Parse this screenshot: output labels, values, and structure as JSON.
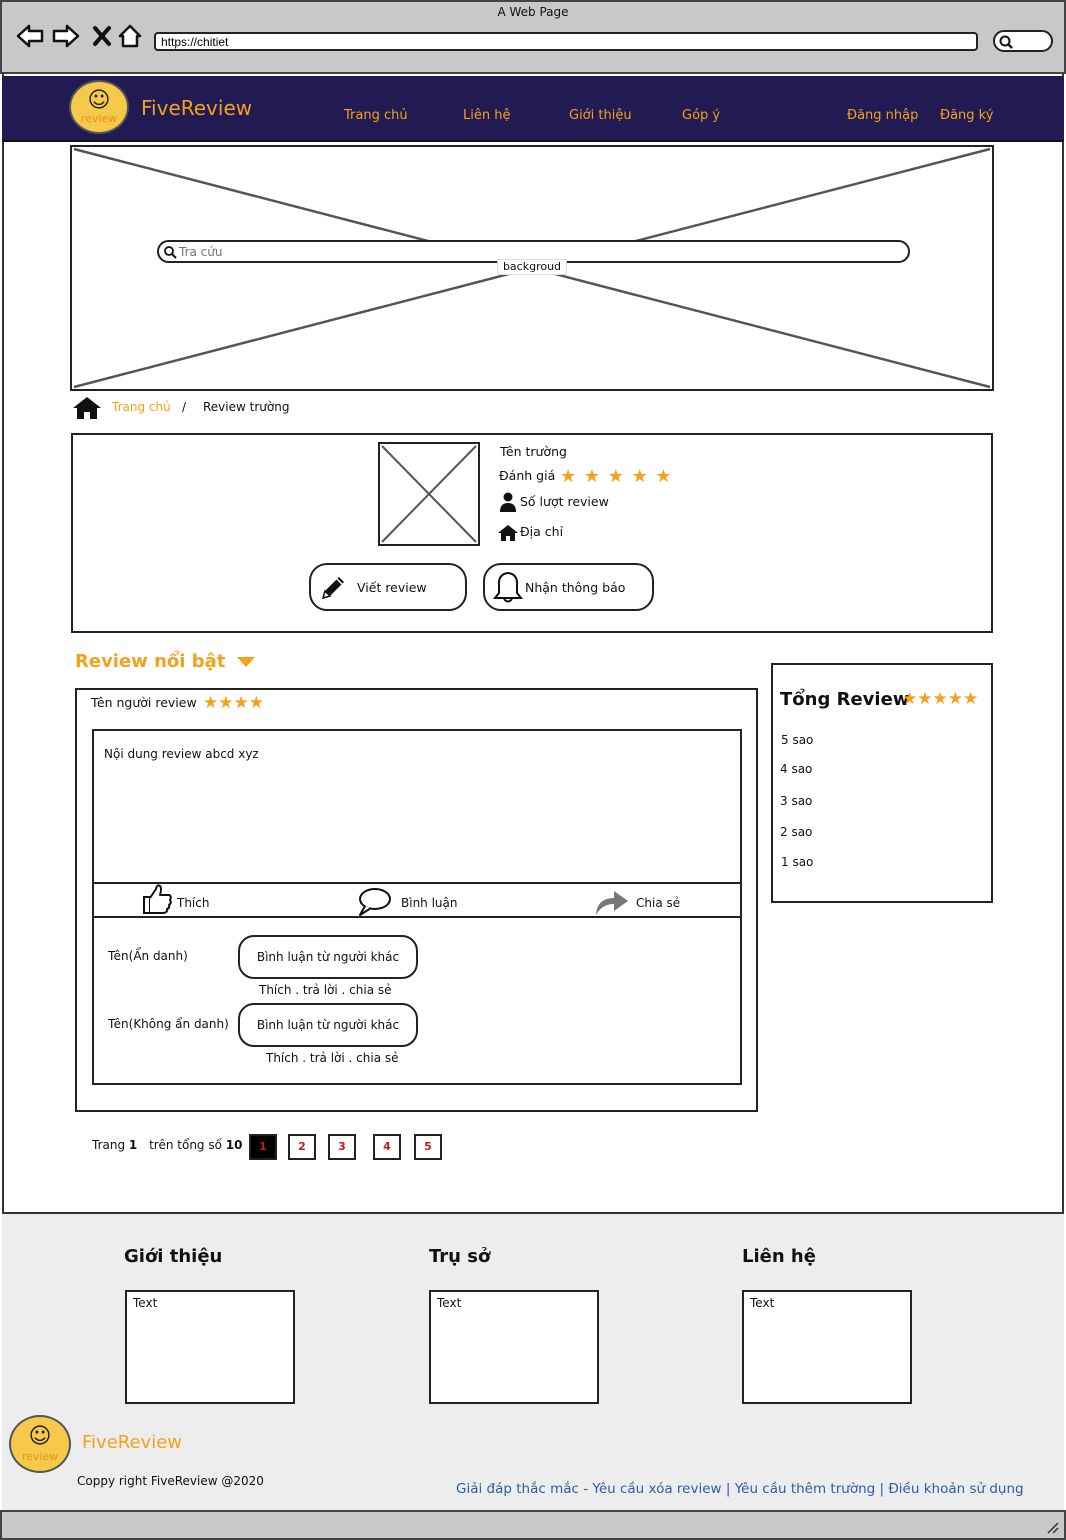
{
  "browser": {
    "window_title": "A Web Page",
    "url": "https://chitiet"
  },
  "brand": {
    "name": "FiveReview",
    "logo_word": "review",
    "logo_face": "☺"
  },
  "nav": {
    "items": [
      "Trang chủ",
      "Liên hệ",
      "Giới thiệu",
      "Góp ý"
    ],
    "login": "Đăng nhập",
    "register": "Đăng ký"
  },
  "hero": {
    "search_placeholder": "Tra cứu",
    "background_label": "backgroud"
  },
  "breadcrumb": {
    "home": "Trang chủ",
    "separator": "/",
    "current": "Review trường"
  },
  "school": {
    "name_label": "Tên trường",
    "rating_label": "Đánh giá",
    "rating_stars": "★ ★ ★ ★ ★",
    "review_count_label": "Số lượt review",
    "address_label": "Địa chỉ",
    "write_review": "Viết review",
    "notify": "Nhận thông báo"
  },
  "featured": {
    "title": "Review nổi bật",
    "reviewer_name": "Tên người review",
    "reviewer_stars": "★★★★",
    "content": "Nội dung review abcd xyz",
    "actions": {
      "like": "Thích",
      "comment": "Bình luận",
      "share": "Chia sẻ"
    },
    "comments": [
      {
        "author": "Tên(Ẩn danh)",
        "text": "Bình luận từ người khác",
        "meta": "Thích . trả lời . chia sẻ"
      },
      {
        "author": "Tên(Không ẩn danh)",
        "text": "Bình luận từ người khác",
        "meta": "Thích . trả lời . chia sẻ"
      }
    ]
  },
  "summary": {
    "title": "Tổng Review",
    "stars": "★★★★★",
    "levels": [
      "5 sao",
      "4 sao",
      "3 sao",
      "2 sao",
      "1 sao"
    ]
  },
  "pagination": {
    "page_label": "Trang",
    "current_page": "1",
    "total_label": "trên tổng số",
    "total": "10",
    "pages": [
      "1",
      "2",
      "3",
      "4",
      "5"
    ]
  },
  "footer": {
    "columns": [
      {
        "heading": "Giới thiệu",
        "text": "Text"
      },
      {
        "heading": "Trụ sở",
        "text": "Text"
      },
      {
        "heading": "Liên hệ",
        "text": "Text"
      }
    ],
    "copyright": "Coppy right FiveReview @2020",
    "links": "Giải đáp thắc mắc - Yêu cầu xóa review | Yêu cầu thêm trường | Điều khoản sử dụng"
  },
  "colors": {
    "navbar": "#221a52",
    "accent": "#f4a11b",
    "logo": "#f6c94a",
    "footer_link": "#2b5ea7",
    "page_number": "#c0201d"
  }
}
